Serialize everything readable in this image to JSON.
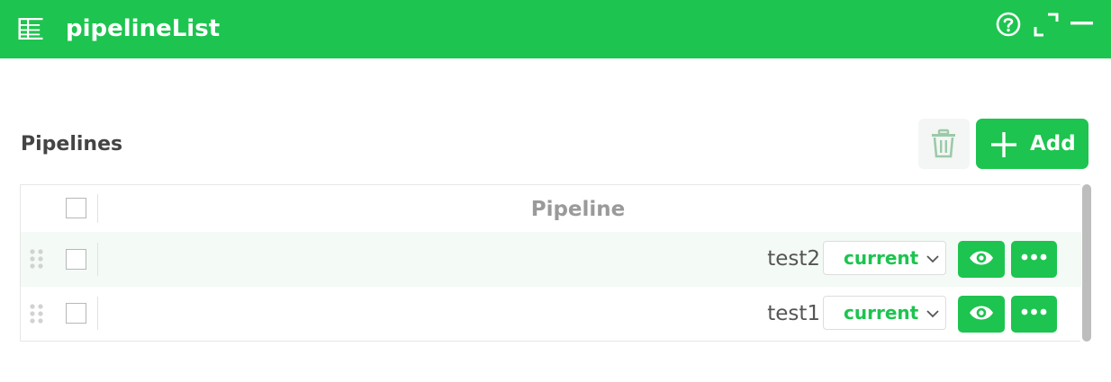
{
  "window": {
    "title": "pipelineList",
    "icons": {
      "app": "table-columns-icon",
      "help": "help-circle-icon",
      "expand": "expand-icon",
      "minimize": "minimize-icon"
    }
  },
  "section": {
    "title": "Pipelines"
  },
  "toolbar": {
    "delete_icon": "trash-icon",
    "add_label": "Add",
    "add_icon": "plus-icon"
  },
  "table": {
    "column_header": "Pipeline",
    "rows": [
      {
        "name": "test2",
        "version": "current"
      },
      {
        "name": "test1",
        "version": "current"
      }
    ],
    "row_icons": {
      "drag": "drag-handle-icon",
      "view": "eye-icon",
      "more": "more-horizontal-icon",
      "dropdown": "chevron-down-icon"
    }
  },
  "colors": {
    "accent": "#1dc44f",
    "row_highlight": "#f4faf5",
    "header_text": "#9a9a9a"
  }
}
